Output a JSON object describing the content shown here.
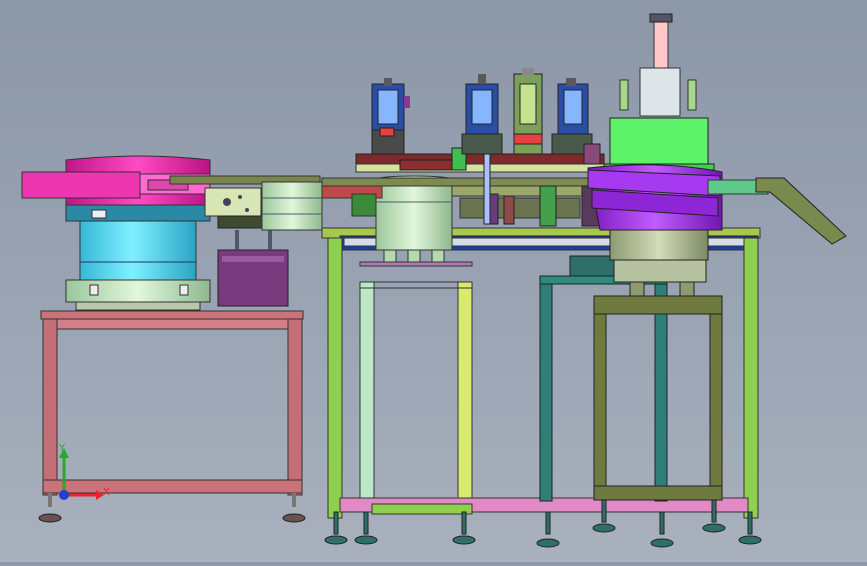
{
  "triad": {
    "x_label": "X",
    "y_label": "Y",
    "x_color": "#e8262a",
    "y_color": "#2ea52b",
    "z_color": "#1f3fd0"
  },
  "colors": {
    "background": "#99a3b2",
    "frame_left": "#c9737a",
    "frame_green": "#8fd14f",
    "frame_teal": "#2f7f78",
    "frame_olive": "#6f7a3e",
    "bowl_magenta": "#e02aa6",
    "bowl_cyan": "#3fd0e8",
    "bowl_purple": "#9a2ee0",
    "block_green": "#5ef26a",
    "hopper_purple": "#7a3b7e",
    "outline": "#222222"
  }
}
